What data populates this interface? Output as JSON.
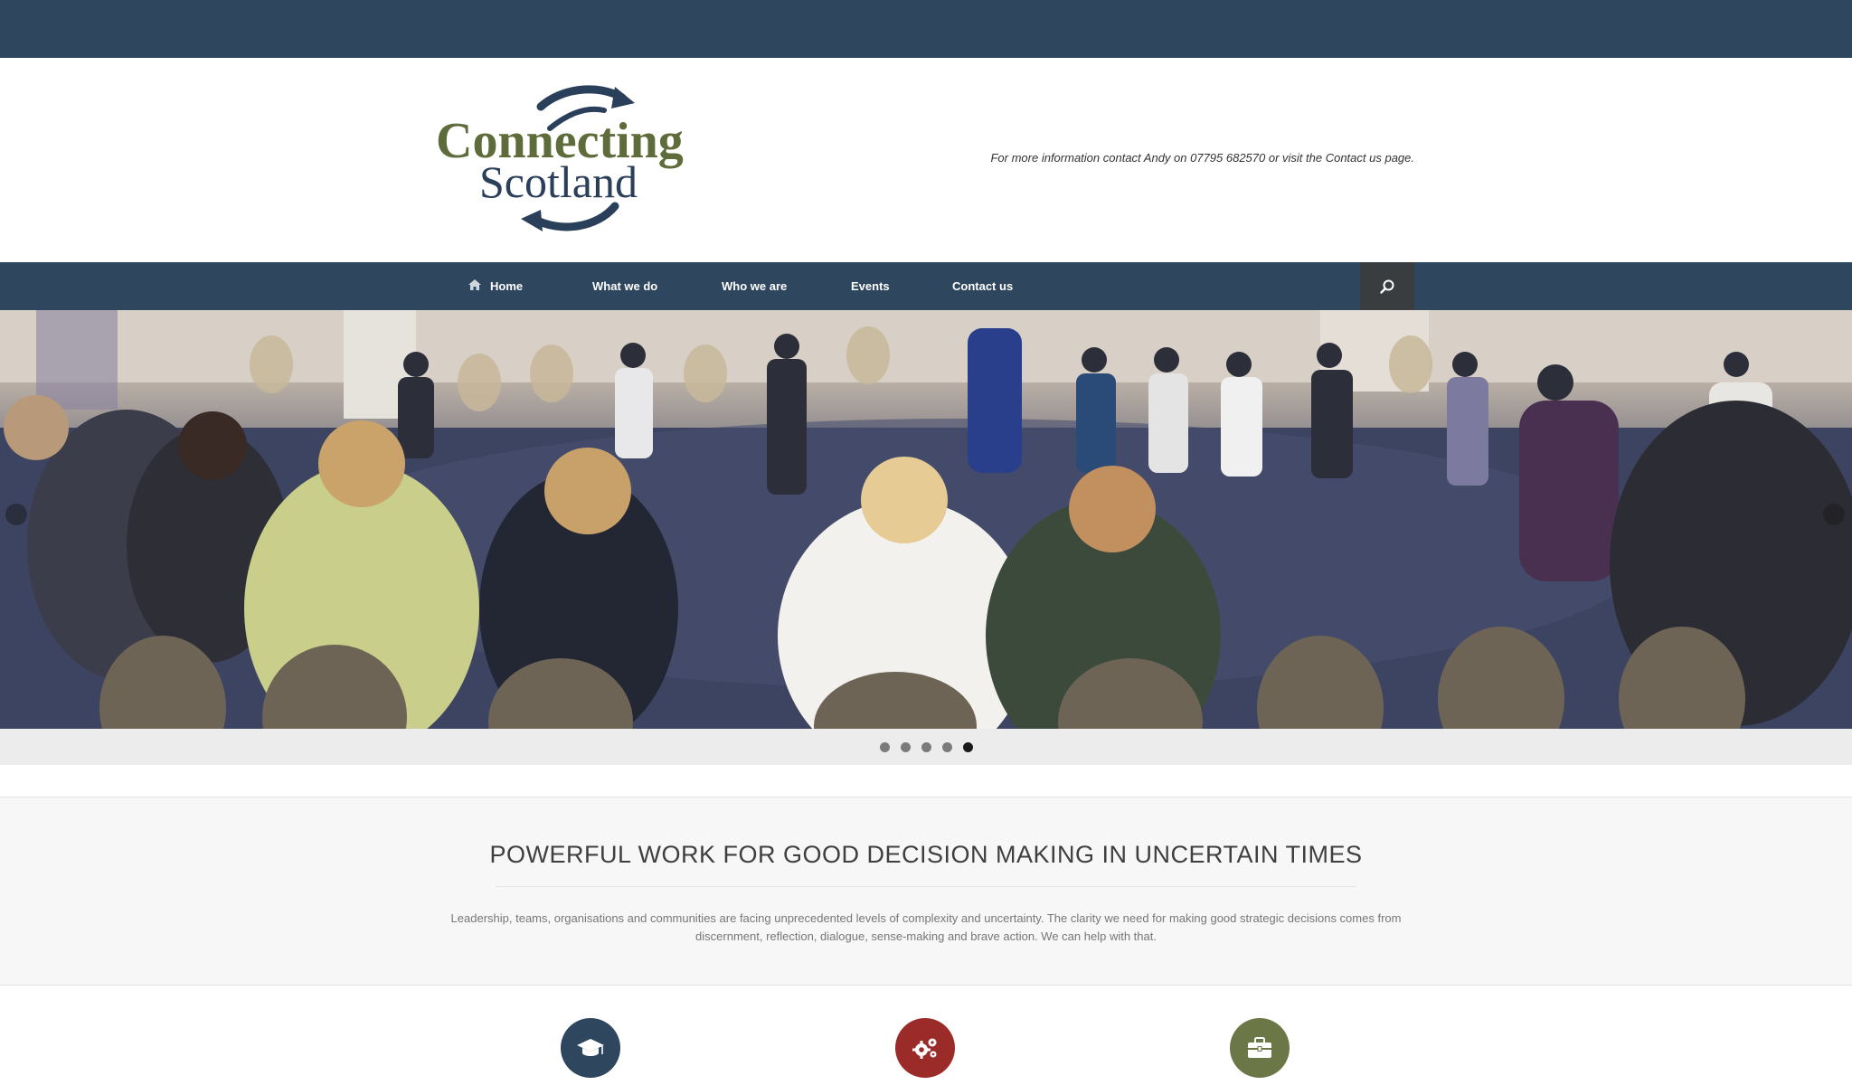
{
  "header": {
    "logo_line1": "Connecting",
    "logo_line2": "Scotland",
    "contact_text": "For more information contact Andy on 07795 682570 or visit the Contact us page."
  },
  "nav": {
    "items": [
      {
        "label": "Home",
        "icon": "home-icon"
      },
      {
        "label": "What we do"
      },
      {
        "label": "Who we are"
      },
      {
        "label": "Events"
      },
      {
        "label": "Contact us"
      }
    ],
    "search_icon": "search-icon"
  },
  "hero": {
    "slide_count": 5,
    "active_slide": 5
  },
  "intro": {
    "title": "POWERFUL WORK FOR GOOD DECISION MAKING IN UNCERTAIN TIMES",
    "text": "Leadership, teams, organisations and communities are facing unprecedented levels of complexity and uncertainty. The clarity we need for making good strategic decisions comes from discernment, reflection, dialogue, sense-making and brave action. We can help with that."
  },
  "features": [
    {
      "icon": "graduation-cap-icon",
      "color": "#2e465e"
    },
    {
      "icon": "gears-icon",
      "color": "#9b2b28"
    },
    {
      "icon": "briefcase-icon",
      "color": "#6b7746"
    }
  ],
  "colors": {
    "primary": "#2e465e",
    "logo_green": "#5e6b3a",
    "logo_navy": "#2a3f5a"
  }
}
